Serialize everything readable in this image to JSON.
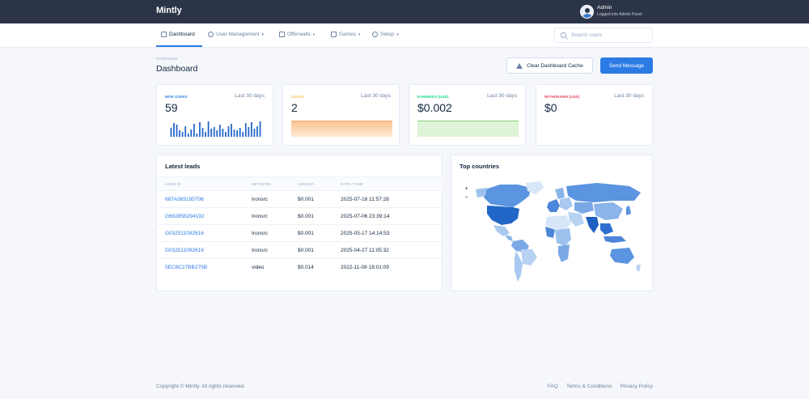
{
  "app": {
    "brand": "Mintly"
  },
  "profile": {
    "name": "Admin",
    "role": "Logged into Admin Panel"
  },
  "nav": {
    "items": [
      {
        "label": "Dashboard",
        "icon": "home-icon"
      },
      {
        "label": "User Management",
        "icon": "user-icon"
      },
      {
        "label": "Offerwalls",
        "icon": "grid-icon"
      },
      {
        "label": "Games",
        "icon": "gamepad-icon"
      },
      {
        "label": "Setup",
        "icon": "gear-icon"
      }
    ],
    "search_placeholder": "Search users"
  },
  "header": {
    "pretitle": "OVERVIEW",
    "title": "Dashboard",
    "clear_cache_label": "Clear Dashboard Cache",
    "send_message_label": "Send Message"
  },
  "stats": [
    {
      "label": "NEW USERS",
      "period": "Last 30 days",
      "value": "59",
      "color": "#2c7be5",
      "spark": [
        0.55,
        0.85,
        0.75,
        0.4,
        0.3,
        0.65,
        0.2,
        0.45,
        0.8,
        0.2,
        0.9,
        0.55,
        0.3,
        0.95,
        0.5,
        0.6,
        0.4,
        0.75,
        0.5,
        0.3,
        0.65,
        0.8,
        0.45,
        0.4,
        0.55,
        0.3,
        0.85,
        0.6,
        0.9,
        0.5,
        0.65,
        0.95
      ]
    },
    {
      "label": "LEADS",
      "period": "Last 30 days",
      "value": "2",
      "color": "#f6c343"
    },
    {
      "label": "EARNINGS (USD)",
      "period": "Last 30 days",
      "value": "$0.002",
      "color": "#00d97e"
    },
    {
      "label": "WITHDRAWN (USD)",
      "period": "Last 30 days",
      "value": "$0",
      "color": "#e63757"
    }
  ],
  "leads": {
    "title": "Latest leads",
    "columns": [
      "USER ID",
      "NETWORK",
      "AMOUNT",
      "DATE / TIME"
    ],
    "rows": [
      {
        "user_id": "687A365195706",
        "network": "Ironsrc",
        "amount": "$0.001",
        "datetime": "2025-07-18 11:57:28"
      },
      {
        "user_id": "G692858294192",
        "network": "Ironsrc",
        "amount": "$0.001",
        "datetime": "2025-07-06 23:39:14"
      },
      {
        "user_id": "G032511092616",
        "network": "Ironsrc",
        "amount": "$0.001",
        "datetime": "2025-05-17 14:14:53"
      },
      {
        "user_id": "G032511092616",
        "network": "Ironsrc",
        "amount": "$0.001",
        "datetime": "2025-04-27 11:05:32"
      },
      {
        "user_id": "5EC8C27BB275B",
        "network": "video",
        "amount": "$0.014",
        "datetime": "2022-11-08 18:01:09"
      }
    ]
  },
  "map": {
    "title": "Top countries",
    "zoom_in": "+",
    "zoom_out": "−"
  },
  "footer": {
    "copyright": "Copyright © Mintly. All rights reserved.",
    "links": [
      "FAQ",
      "Terms & Conditions",
      "Privacy Policy"
    ],
    "separator": "·"
  }
}
